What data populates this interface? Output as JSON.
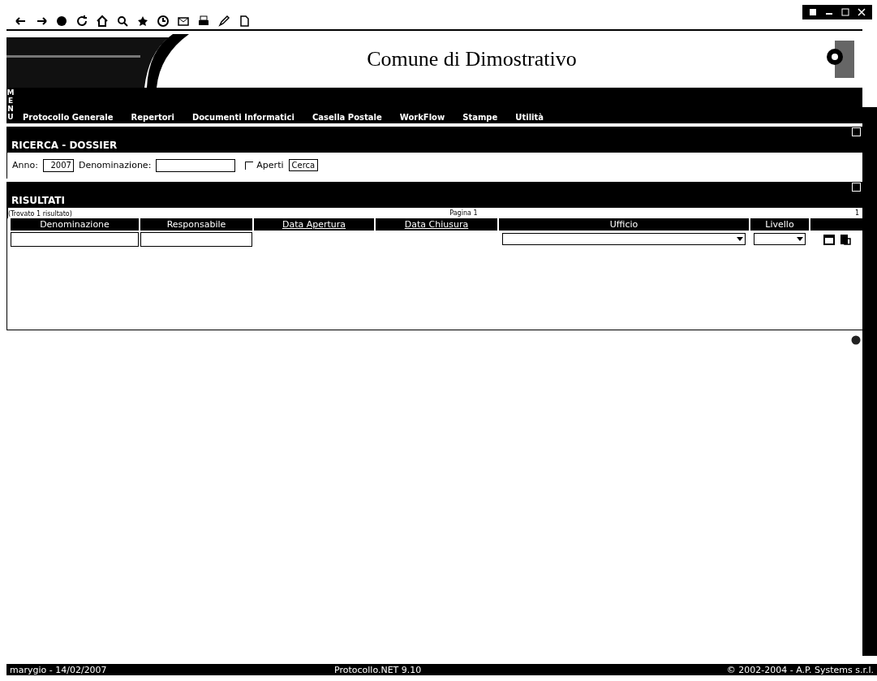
{
  "header": {
    "title": "Comune di Dimostrativo",
    "menu_label": "MENU"
  },
  "menu": [
    {
      "label": "Protocollo Generale"
    },
    {
      "label": "Repertori"
    },
    {
      "label": "Documenti Informatici"
    },
    {
      "label": "Casella Postale"
    },
    {
      "label": "WorkFlow"
    },
    {
      "label": "Stampe"
    },
    {
      "label": "Utilità"
    }
  ],
  "search": {
    "title": "RICERCA - DOSSIER",
    "year_label": "Anno:",
    "year_value": "2007",
    "name_label": "Denominazione:",
    "open_label": "Aperti",
    "open_checked": false,
    "button": "Cerca"
  },
  "results": {
    "title": "RISULTATI",
    "page": "Pagina 1",
    "page_count": "1",
    "found": "(Trovato 1 risultato)",
    "columns": [
      {
        "label": "Denominazione",
        "kind": "text"
      },
      {
        "label": "Responsabile",
        "kind": "text"
      },
      {
        "label": "Data Apertura",
        "kind": "link"
      },
      {
        "label": "Data Chiusura",
        "kind": "link"
      },
      {
        "label": "Ufficio",
        "kind": "select"
      },
      {
        "label": "Livello",
        "kind": "select"
      },
      {
        "kind": "actions"
      }
    ]
  },
  "status_bar": {
    "user": "marygio - 14/02/2007",
    "product": "Protocollo.NET 9.10",
    "copyright": "© 2002-2004 - A.P. Systems s.r.l."
  }
}
